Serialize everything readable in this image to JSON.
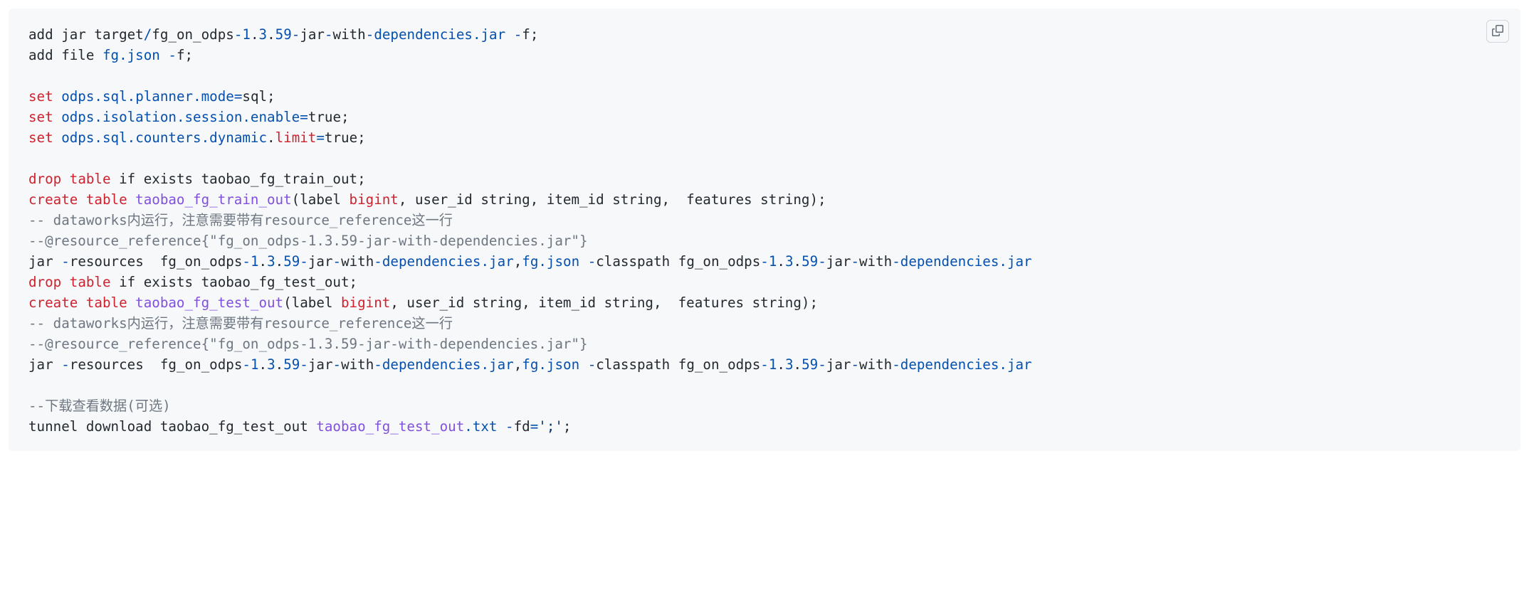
{
  "code": {
    "l1a": "add jar target",
    "l1b": "/",
    "l1c": "fg_on_odps",
    "l1d": "-",
    "l1e": "1",
    "l1f": ".",
    "l1g": "3",
    "l1h": ".",
    "l1i": "59",
    "l1j": "-",
    "l1k": "jar",
    "l1l": "-",
    "l1m": "with",
    "l1n": "-",
    "l1o": "dependencies",
    "l1p": ".jar",
    "l1q": " -",
    "l1r": "f;",
    "l2a": "add file ",
    "l2b": "fg",
    "l2c": ".json",
    "l2d": " -",
    "l2e": "f;",
    "l3a": "set",
    "l3b": " odps",
    "l3c": ".sql",
    "l3d": ".planner",
    "l3e": ".mode",
    "l3f": "=",
    "l3g": "sql;",
    "l4a": "set",
    "l4b": " odps",
    "l4c": ".isolation",
    "l4d": ".session",
    "l4e": ".enable",
    "l4f": "=",
    "l4g": "true;",
    "l5a": "set",
    "l5b": " odps",
    "l5c": ".sql",
    "l5d": ".counters",
    "l5e": ".dynamic",
    "l5f": ".",
    "l5g": "limit",
    "l5h": "=",
    "l5i": "true;",
    "l6a": "drop",
    "l6b": " table",
    "l6c": " if exists taobao_fg_train_out;",
    "l7a": "create",
    "l7b": " table",
    "l7c": " taobao_fg_train_out",
    "l7d": "(label ",
    "l7e": "bigint",
    "l7f": ", user_id string, item_id string,  features string);",
    "l8": "-- dataworks内运行，注意需要带有resource_reference这一行",
    "l9": "--@resource_reference{\"fg_on_odps-1.3.59-jar-with-dependencies.jar\"}",
    "l10a": "jar ",
    "l10b": "-",
    "l10c": "resources  fg_on_odps",
    "l10d": "-",
    "l10e": "1",
    "l10f": ".",
    "l10g": "3",
    "l10h": ".",
    "l10i": "59",
    "l10j": "-",
    "l10k": "jar",
    "l10l": "-",
    "l10m": "with",
    "l10n": "-",
    "l10o": "dependencies",
    "l10p": ".jar",
    "l10q": ",",
    "l10r": "fg",
    "l10s": ".json",
    "l10t": " -",
    "l10u": "classpath fg_on_odps",
    "l10v": "-",
    "l10w": "1",
    "l10x": ".",
    "l10y": "3",
    "l10z": ".",
    "l10aa": "59",
    "l10ab": "-",
    "l10ac": "jar",
    "l10ad": "-",
    "l10ae": "with",
    "l10af": "-",
    "l10ag": "dependencies",
    "l10ah": ".jar",
    "l11a": "drop",
    "l11b": " table",
    "l11c": " if exists taobao_fg_test_out;",
    "l12a": "create",
    "l12b": " table",
    "l12c": " taobao_fg_test_out",
    "l12d": "(label ",
    "l12e": "bigint",
    "l12f": ", user_id string, item_id string,  features string);",
    "l13": "-- dataworks内运行，注意需要带有resource_reference这一行",
    "l14": "--@resource_reference{\"fg_on_odps-1.3.59-jar-with-dependencies.jar\"}",
    "l15a": "jar ",
    "l15b": "-",
    "l15c": "resources  fg_on_odps",
    "l15d": "-",
    "l15e": "1",
    "l15f": ".",
    "l15g": "3",
    "l15h": ".",
    "l15i": "59",
    "l15j": "-",
    "l15k": "jar",
    "l15l": "-",
    "l15m": "with",
    "l15n": "-",
    "l15o": "dependencies",
    "l15p": ".jar",
    "l15q": ",",
    "l15r": "fg",
    "l15s": ".json",
    "l15t": " -",
    "l15u": "classpath fg_on_odps",
    "l15v": "-",
    "l15w": "1",
    "l15x": ".",
    "l15y": "3",
    "l15z": ".",
    "l15aa": "59",
    "l15ab": "-",
    "l15ac": "jar",
    "l15ad": "-",
    "l15ae": "with",
    "l15af": "-",
    "l15ag": "dependencies",
    "l15ah": ".jar",
    "l16": "--下载查看数据(可选)",
    "l17a": "tunnel download taobao_fg_test_out ",
    "l17b": "taobao_fg_test_out",
    "l17c": ".txt",
    "l17d": " -",
    "l17e": "fd",
    "l17f": "=",
    "l17g": "';'",
    "l17h": ";"
  },
  "ui": {
    "copy_label": "Copy"
  }
}
